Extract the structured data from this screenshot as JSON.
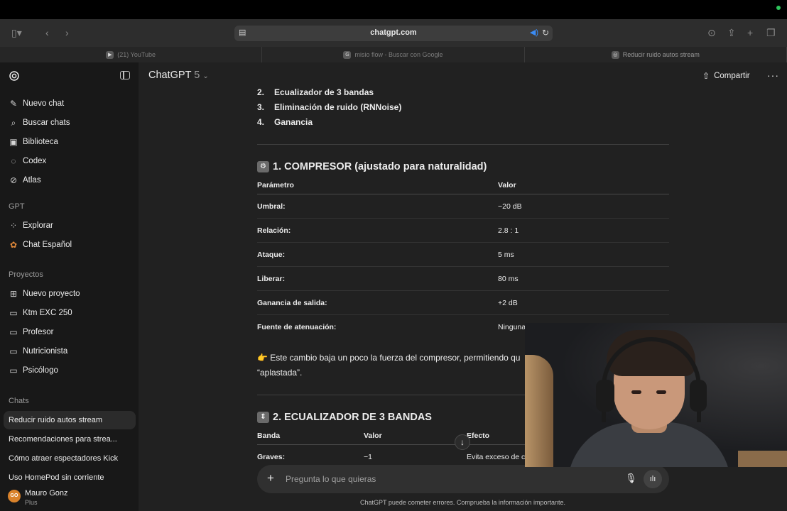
{
  "browser": {
    "url": "chatgpt.com",
    "tabs": [
      {
        "label": "(21) YouTube"
      },
      {
        "label": "misio flow - Buscar con Google"
      },
      {
        "label": "Reducir ruido autos stream"
      }
    ]
  },
  "sidebar": {
    "top_items": [
      {
        "label": "Nuevo chat",
        "icon": "edit-icon"
      },
      {
        "label": "Buscar chats",
        "icon": "search-icon"
      },
      {
        "label": "Biblioteca",
        "icon": "library-icon"
      },
      {
        "label": "Codex",
        "icon": "codex-icon"
      },
      {
        "label": "Atlas",
        "icon": "atlas-icon"
      }
    ],
    "gpt_section": "GPT",
    "gpt_items": [
      {
        "label": "Explorar",
        "icon": "grid-icon"
      },
      {
        "label": "Chat Español",
        "icon": "gpt-avatar-icon"
      }
    ],
    "projects_section": "Proyectos",
    "project_items": [
      {
        "label": "Nuevo proyecto"
      },
      {
        "label": "Ktm EXC 250"
      },
      {
        "label": "Profesor"
      },
      {
        "label": "Nutricionista"
      },
      {
        "label": "Psicólogo"
      }
    ],
    "chats_section": "Chats",
    "chats": [
      {
        "label": "Reducir ruido autos stream"
      },
      {
        "label": "Recomendaciones para strea..."
      },
      {
        "label": "Cómo atraer espectadores Kick"
      },
      {
        "label": "Uso HomePod sin corriente"
      }
    ],
    "user": {
      "initials": "GO",
      "name": "Mauro Gonz",
      "plan": "Plus"
    }
  },
  "header": {
    "model_name": "ChatGPT",
    "model_version": "5",
    "share_label": "Compartir"
  },
  "content": {
    "list": [
      {
        "num": "2.",
        "text": "Ecualizador de 3 bandas"
      },
      {
        "num": "3.",
        "text": "Eliminación de ruido (RNNoise)"
      },
      {
        "num": "4.",
        "text": "Ganancia"
      }
    ],
    "section1": {
      "title": "1. COMPRESOR (ajustado para naturalidad)",
      "headers": [
        "Parámetro",
        "Valor"
      ],
      "rows": [
        [
          "Umbral:",
          "−20 dB"
        ],
        [
          "Relación:",
          "2.8 : 1"
        ],
        [
          "Ataque:",
          "5 ms"
        ],
        [
          "Liberar:",
          "80 ms"
        ],
        [
          "Ganancia de salida:",
          "+2 dB"
        ],
        [
          "Fuente de atenuación:",
          "Ninguna"
        ]
      ]
    },
    "note_line1": "👉 Este cambio baja un poco la fuerza del compresor, permitiendo qu",
    "note_line2": "“aplastada”.",
    "section2": {
      "title": "2. ECUALIZADOR DE 3 BANDAS",
      "headers": [
        "Banda",
        "Valor",
        "Efecto"
      ],
      "rows": [
        [
          "Graves:",
          "−1",
          "Evita exceso de c"
        ]
      ]
    }
  },
  "composer": {
    "placeholder": "Pregunta lo que quieras"
  },
  "disclaimer": "ChatGPT puede cometer errores. Comprueba la información importante."
}
